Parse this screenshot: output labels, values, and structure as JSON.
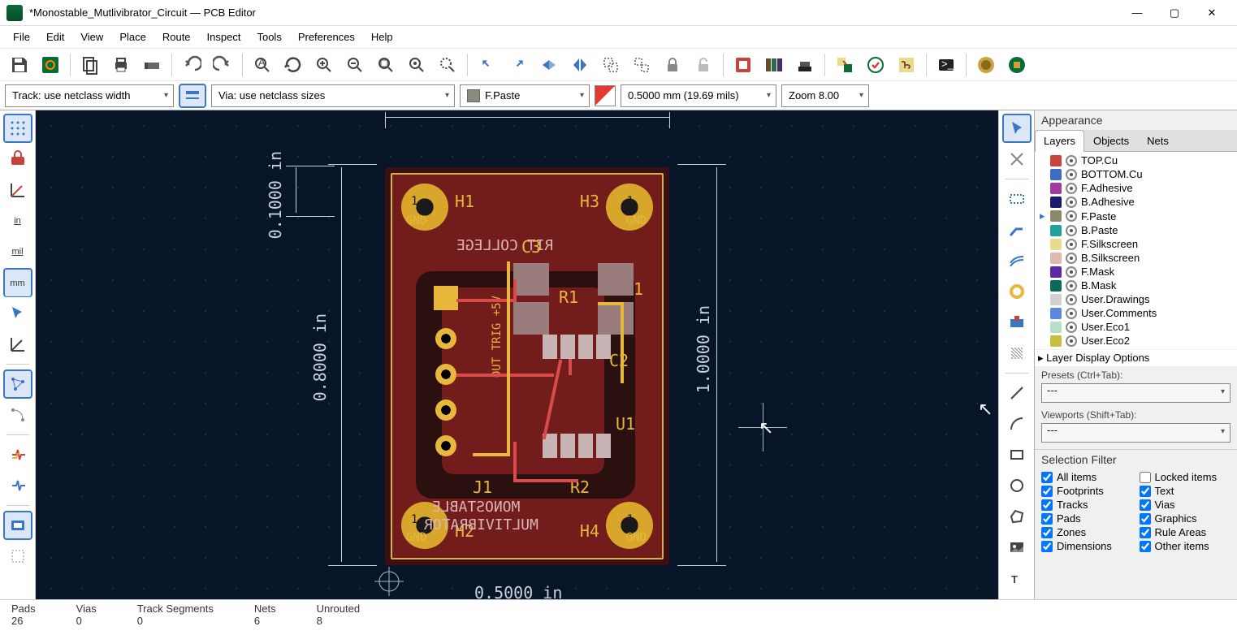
{
  "window": {
    "title": "*Monostable_Mutlivibrator_Circuit — PCB Editor"
  },
  "menu": [
    "File",
    "Edit",
    "View",
    "Place",
    "Route",
    "Inspect",
    "Tools",
    "Preferences",
    "Help"
  ],
  "options": {
    "track": "Track: use netclass width",
    "via": "Via: use netclass sizes",
    "layer": "F.Paste",
    "grid": "0.5000 mm (19.69 mils)",
    "zoom": "Zoom 8.00"
  },
  "left_tools": {
    "unit_in": "in",
    "unit_mil": "mil",
    "unit_mm": "mm"
  },
  "canvas": {
    "dim_top": "",
    "dim_left_small": "0.1000  in",
    "dim_left_big": "0.8000  in",
    "dim_right": "1.0000  in",
    "dim_bottom": "0.5000  in",
    "refs": {
      "h1": "H1",
      "h2": "H2",
      "h3": "H3",
      "h4": "H4",
      "c1": "C1",
      "c2": "C2",
      "c3": "C3",
      "r1": "R1",
      "r2": "R2",
      "u1": "U1",
      "j1": "J1"
    },
    "gnd": "GND",
    "hole_num": "1",
    "silk1": "RIT COLLEGE",
    "silk2": "MONOSTABLE",
    "silk3": "MULTIVIBRATOR",
    "silk_vert": "OUT TRIG +5V",
    "pad5v": "+5V",
    "padout": "OUT",
    "padgnd": "GND"
  },
  "appearance": {
    "title": "Appearance",
    "tabs": [
      "Layers",
      "Objects",
      "Nets"
    ],
    "layers": [
      {
        "name": "TOP.Cu",
        "color": "#c8443a"
      },
      {
        "name": "BOTTOM.Cu",
        "color": "#3a6cc8"
      },
      {
        "name": "F.Adhesive",
        "color": "#a23aa2"
      },
      {
        "name": "B.Adhesive",
        "color": "#1a1a6a"
      },
      {
        "name": "F.Paste",
        "color": "#8a8a6a"
      },
      {
        "name": "B.Paste",
        "color": "#1ea29a"
      },
      {
        "name": "F.Silkscreen",
        "color": "#e6dc8a"
      },
      {
        "name": "B.Silkscreen",
        "color": "#e0b8b0"
      },
      {
        "name": "F.Mask",
        "color": "#5a2aa2"
      },
      {
        "name": "B.Mask",
        "color": "#0a6b5a"
      },
      {
        "name": "User.Drawings",
        "color": "#d0d0d0"
      },
      {
        "name": "User.Comments",
        "color": "#5a8ae0"
      },
      {
        "name": "User.Eco1",
        "color": "#b8e0c8"
      },
      {
        "name": "User.Eco2",
        "color": "#c8c03a"
      }
    ],
    "display_opts": "Layer Display Options",
    "presets_label": "Presets (Ctrl+Tab):",
    "viewports_label": "Viewports (Shift+Tab):",
    "preset_val": "---",
    "viewport_val": "---"
  },
  "filter": {
    "title": "Selection Filter",
    "items": [
      {
        "label": "All items",
        "checked": true
      },
      {
        "label": "Locked items",
        "checked": false
      },
      {
        "label": "Footprints",
        "checked": true
      },
      {
        "label": "Text",
        "checked": true
      },
      {
        "label": "Tracks",
        "checked": true
      },
      {
        "label": "Vias",
        "checked": true
      },
      {
        "label": "Pads",
        "checked": true
      },
      {
        "label": "Graphics",
        "checked": true
      },
      {
        "label": "Zones",
        "checked": true
      },
      {
        "label": "Rule Areas",
        "checked": true
      },
      {
        "label": "Dimensions",
        "checked": true
      },
      {
        "label": "Other items",
        "checked": true
      }
    ]
  },
  "status": {
    "pads_l": "Pads",
    "pads_v": "26",
    "vias_l": "Vias",
    "vias_v": "0",
    "tracks_l": "Track Segments",
    "tracks_v": "0",
    "nets_l": "Nets",
    "nets_v": "6",
    "unrouted_l": "Unrouted",
    "unrouted_v": "8"
  }
}
